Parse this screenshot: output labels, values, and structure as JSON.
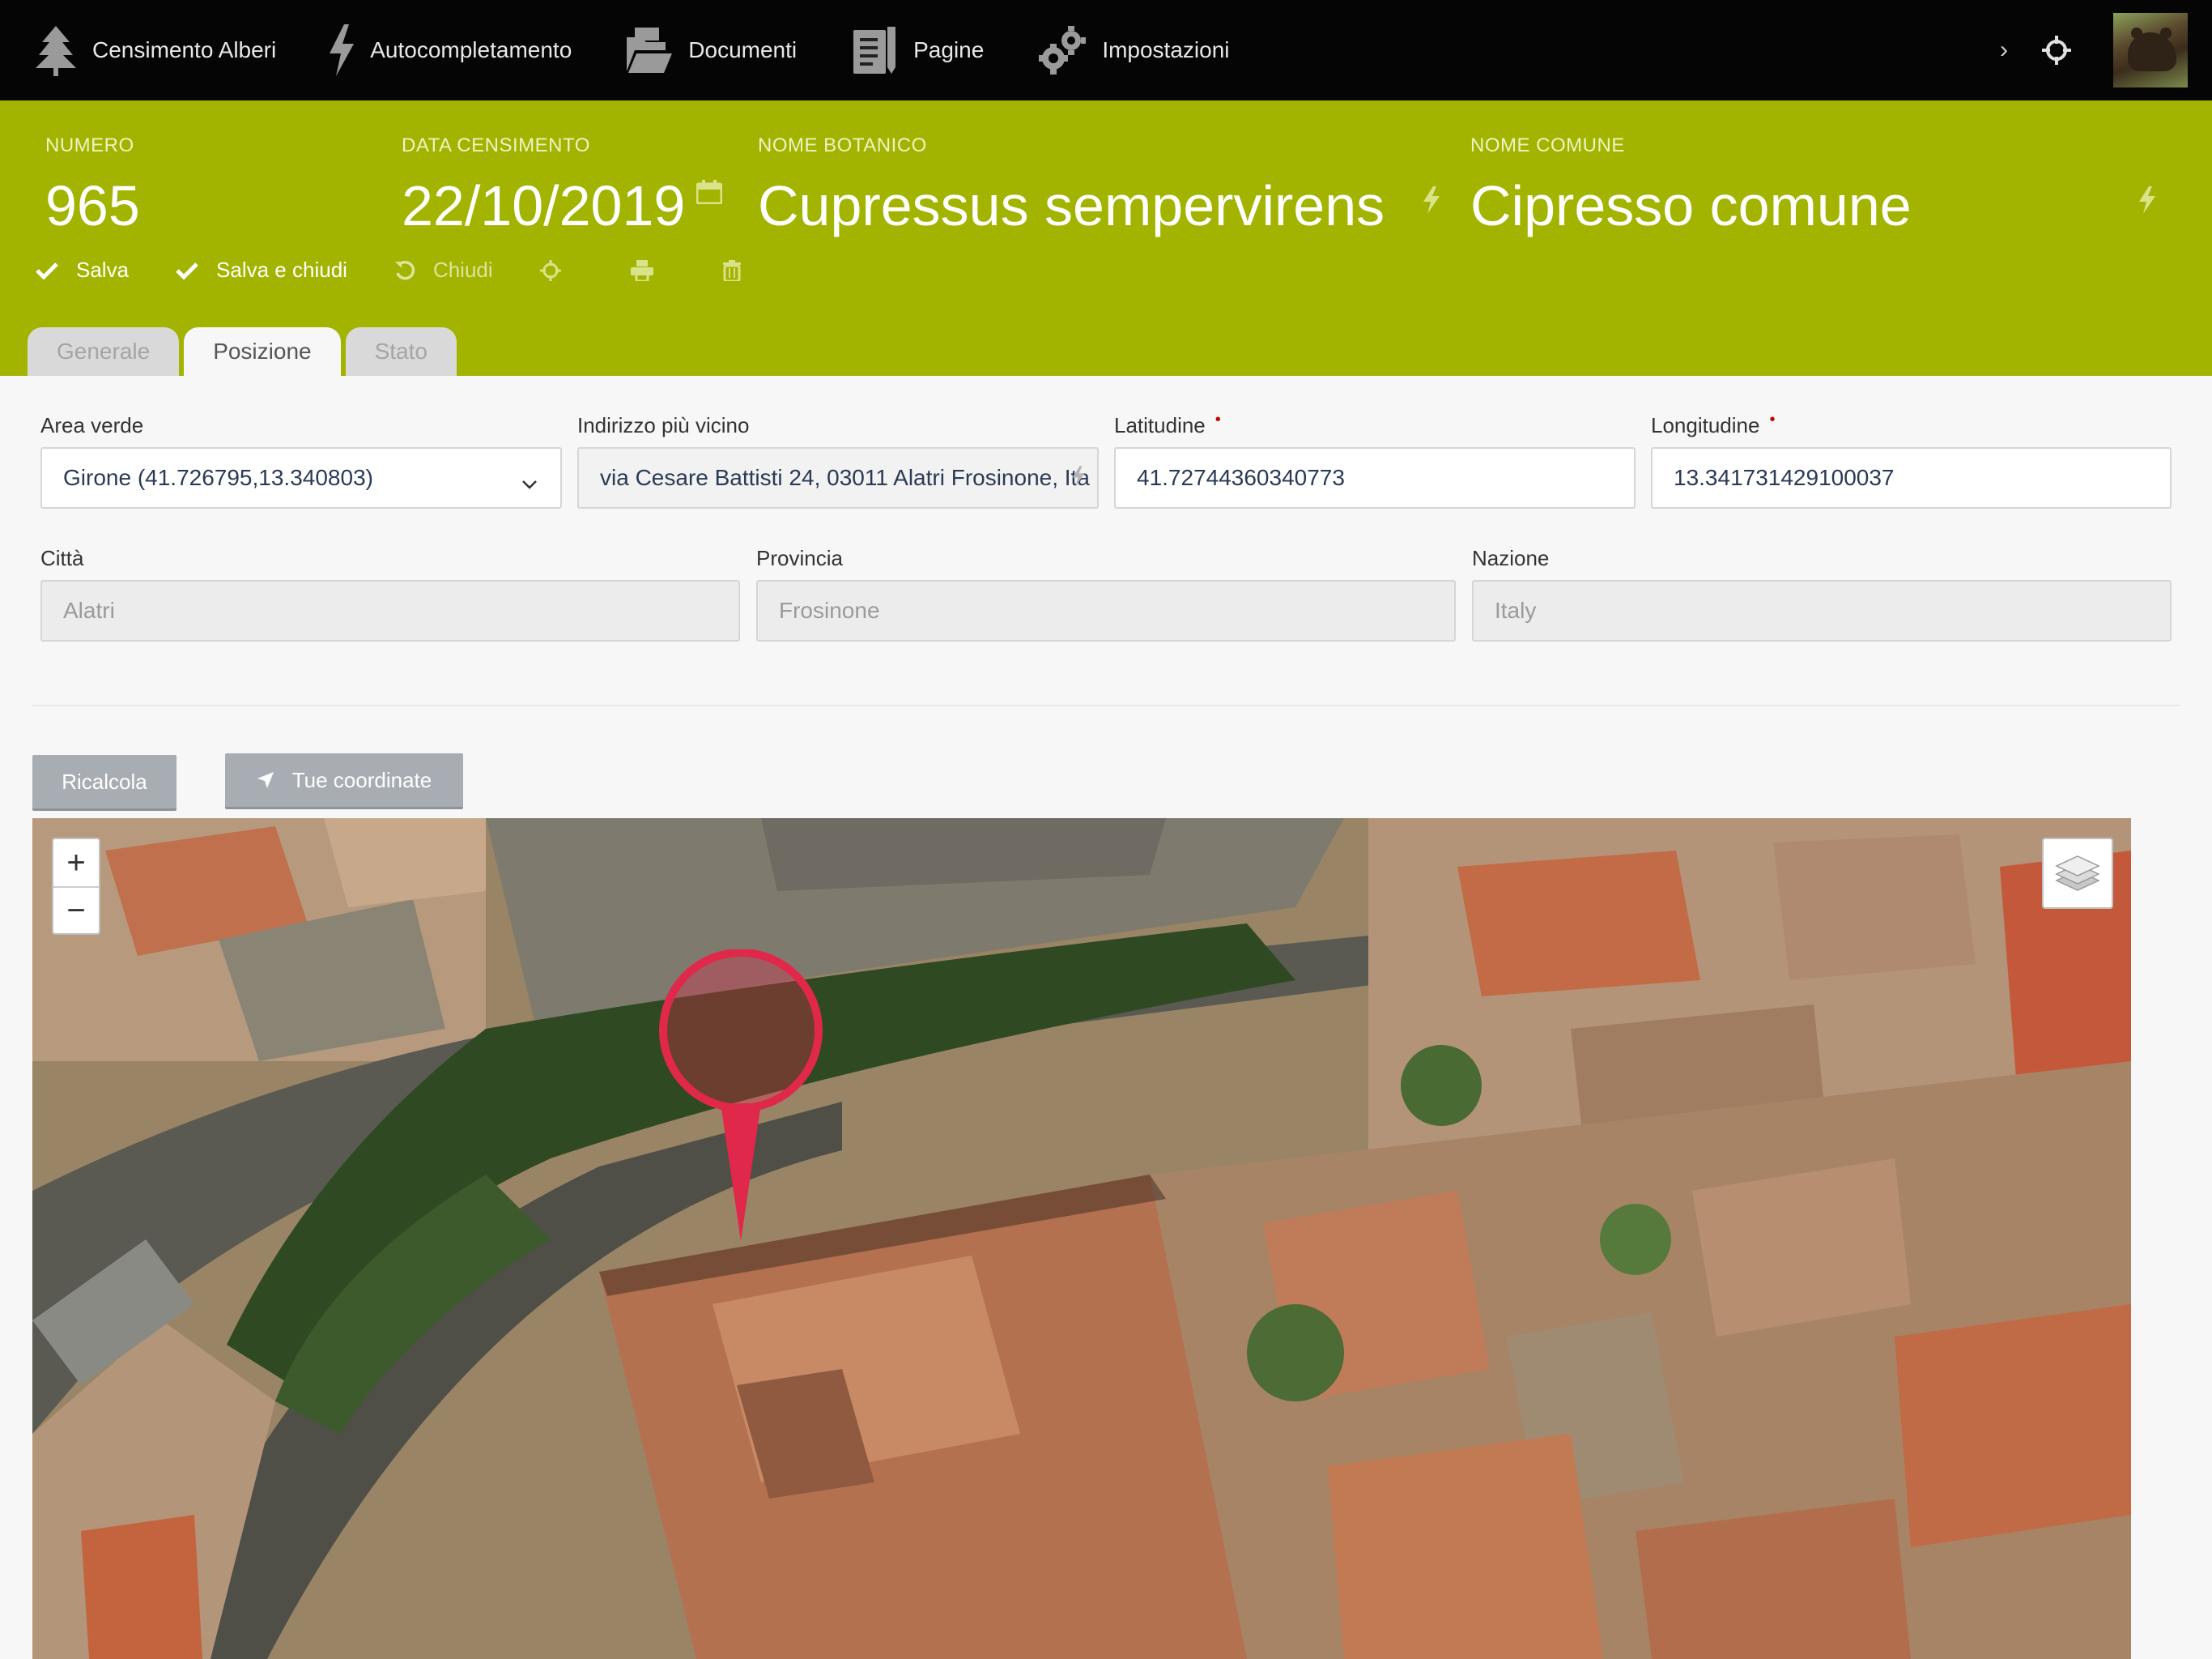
{
  "nav": {
    "items": [
      {
        "label": "Censimento Alberi",
        "icon": "tree-icon"
      },
      {
        "label": "Autocompletamento",
        "icon": "bolt-icon"
      },
      {
        "label": "Documenti",
        "icon": "folder-icon"
      },
      {
        "label": "Pagine",
        "icon": "pages-icon"
      },
      {
        "label": "Impostazioni",
        "icon": "gears-icon"
      }
    ],
    "chevron": "›"
  },
  "header": {
    "numero": {
      "label": "NUMERO",
      "value": "965"
    },
    "data_censimento": {
      "label": "DATA CENSIMENTO",
      "value": "22/10/2019"
    },
    "nome_botanico": {
      "label": "NOME BOTANICO",
      "value": "Cupressus sempervirens"
    },
    "nome_comune": {
      "label": "NOME COMUNE",
      "value": "Cipresso comune"
    },
    "accent_color": "#a2b400"
  },
  "toolbar": {
    "save_label": "Salva",
    "save_close_label": "Salva e chiudi",
    "close_label": "Chiudi"
  },
  "tabs": [
    {
      "label": "Generale",
      "active": false
    },
    {
      "label": "Posizione",
      "active": true
    },
    {
      "label": "Stato",
      "active": false
    }
  ],
  "form": {
    "area_verde": {
      "label": "Area verde",
      "value": "Girone (41.726795,13.340803)"
    },
    "indirizzo": {
      "label": "Indirizzo più vicino",
      "value": "via Cesare Battisti 24, 03011 Alatri Frosinone, Ita"
    },
    "latitudine": {
      "label": "Latitudine",
      "value": "41.72744360340773",
      "required_mark": "•"
    },
    "longitudine": {
      "label": "Longitudine",
      "value": "13.341731429100037",
      "required_mark": "•"
    },
    "citta": {
      "label": "Città",
      "value": "Alatri"
    },
    "provincia": {
      "label": "Provincia",
      "value": "Frosinone"
    },
    "nazione": {
      "label": "Nazione",
      "value": "Italy"
    }
  },
  "actions": {
    "ricalcola_label": "Ricalcola",
    "tue_coordinate_label": "Tue coordinate"
  },
  "map": {
    "zoom_in": "+",
    "zoom_out": "−",
    "marker_color": "#e0284a"
  }
}
